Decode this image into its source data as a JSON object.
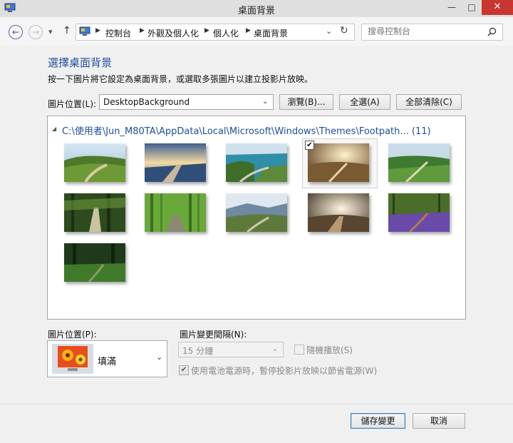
{
  "window": {
    "title": "桌面背景",
    "minimize": "—",
    "maximize": "□",
    "close": "✕"
  },
  "nav": {
    "back": "←",
    "forward": "→",
    "dropdown": "▾",
    "up": "↑",
    "breadcrumb": [
      "控制台",
      "外觀及個人化",
      "個人化",
      "桌面背景"
    ],
    "search_placeholder": "搜尋控制台"
  },
  "main": {
    "heading": "選擇桌面背景",
    "instruction": "按一下圖片將它設定為桌面背景，或選取多張圖片以建立投影片放映。",
    "location_label": "圖片位置(L):",
    "location_value": "DesktopBackground",
    "browse_label": "瀏覽(B)...",
    "select_all_label": "全選(A)",
    "clear_all_label": "全部清除(C)",
    "folder_path": "C:\\使用者\\Jun_M80TA\\AppData\\Local\\Microsoft\\Windows\\Themes\\Footpath... (11)",
    "checkmark": "✔"
  },
  "bottom": {
    "position_label": "圖片位置(P):",
    "position_value": "填滿",
    "interval_label": "圖片變更間隔(N):",
    "interval_value": "15 分鐘",
    "shuffle_label": "隨機播放(S)",
    "battery_label": "使用電池電源時，暫停投影片放映以節省電源(W)"
  },
  "footer": {
    "save_label": "儲存變更",
    "cancel_label": "取消"
  }
}
